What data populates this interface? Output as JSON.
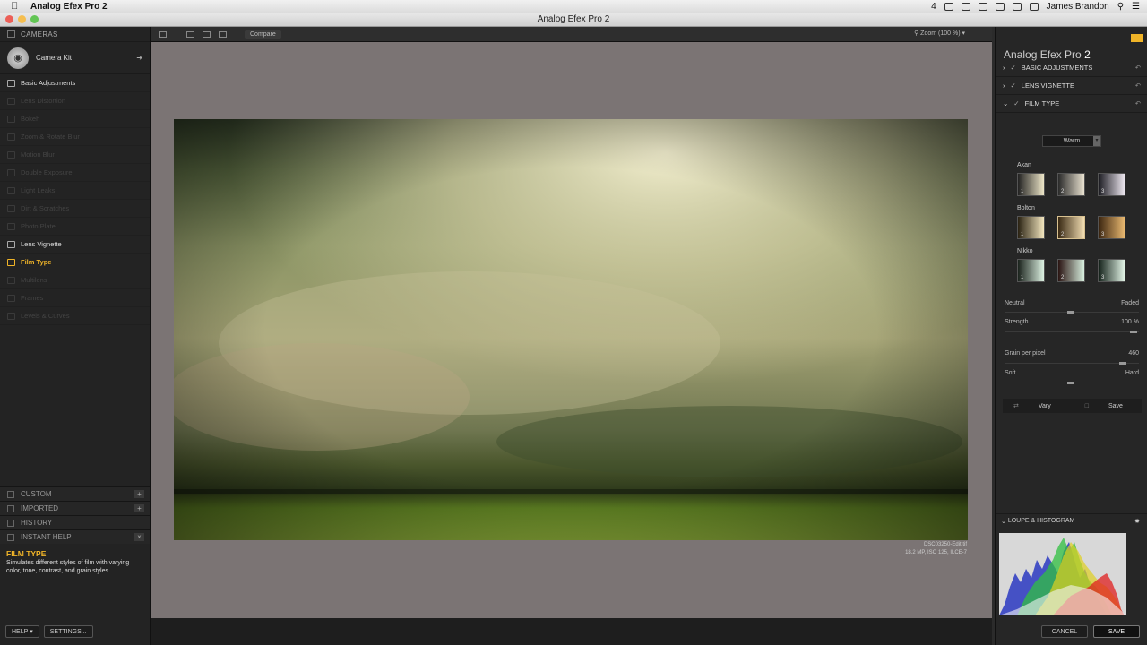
{
  "menubar": {
    "app_name": "Analog Efex Pro 2",
    "user": "James Brandon",
    "badge": "4"
  },
  "window": {
    "title": "Analog Efex Pro 2"
  },
  "left": {
    "cameras_label": "CAMERAS",
    "camera_kit_label": "Camera Kit",
    "filters": [
      {
        "label": "Basic Adjustments",
        "state": "on"
      },
      {
        "label": "Lens Distortion",
        "state": "off"
      },
      {
        "label": "Bokeh",
        "state": "off"
      },
      {
        "label": "Zoom & Rotate Blur",
        "state": "off"
      },
      {
        "label": "Motion Blur",
        "state": "off"
      },
      {
        "label": "Double Exposure",
        "state": "off"
      },
      {
        "label": "Light Leaks",
        "state": "off"
      },
      {
        "label": "Dirt & Scratches",
        "state": "off"
      },
      {
        "label": "Photo Plate",
        "state": "off"
      },
      {
        "label": "Lens Vignette",
        "state": "on"
      },
      {
        "label": "Film Type",
        "state": "active"
      },
      {
        "label": "Multilens",
        "state": "off"
      },
      {
        "label": "Frames",
        "state": "off"
      },
      {
        "label": "Levels & Curves",
        "state": "off"
      }
    ],
    "sections": [
      "CUSTOM",
      "IMPORTED",
      "HISTORY",
      "INSTANT HELP"
    ],
    "help_title": "FILM TYPE",
    "help_text": "Simulates different styles of film with varying color, tone, contrast, and grain styles.",
    "help_button": "HELP",
    "settings_button": "SETTINGS..."
  },
  "toolbar": {
    "compare_label": "Compare",
    "zoom_label": "Zoom (100 %)"
  },
  "image": {
    "filename": "DSC03250-Edit.tif",
    "info": "18.2 MP, ISO 125, ILCE-7"
  },
  "right": {
    "title_main": "Analog Efex Pro",
    "title_num": "2",
    "sections": [
      "BASIC ADJUSTMENTS",
      "LENS VIGNETTE",
      "FILM TYPE"
    ],
    "dropdown_value": "Warm",
    "groups": [
      {
        "name": "Akan",
        "swatches": [
          "1",
          "2",
          "3"
        ]
      },
      {
        "name": "Bolton",
        "swatches": [
          "1",
          "2",
          "3"
        ]
      },
      {
        "name": "Nikko",
        "swatches": [
          "1",
          "2",
          "3"
        ]
      }
    ],
    "neutral_label": "Neutral",
    "faded_label": "Faded",
    "strength_label": "Strength",
    "strength_value": "100 %",
    "grain_label": "Grain per pixel",
    "grain_value": "460",
    "soft_label": "Soft",
    "hard_label": "Hard",
    "vary_label": "Vary",
    "save_label": "Save",
    "loupe_label": "LOUPE & HISTOGRAM",
    "cancel_button": "CANCEL",
    "save_button": "SAVE"
  }
}
